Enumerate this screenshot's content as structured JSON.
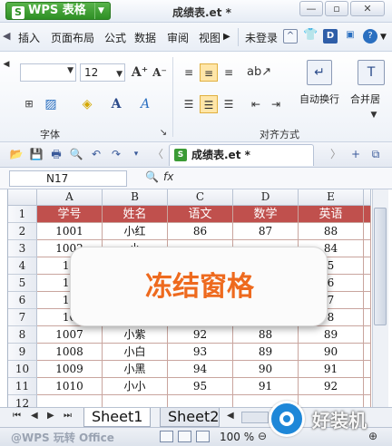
{
  "titlebar": {
    "app_label": "WPS 表格",
    "doc_title": "成绩表.et *"
  },
  "menu": {
    "tabs": [
      "插入",
      "页面布局",
      "公式",
      "数据",
      "审阅",
      "视图"
    ],
    "login": "未登录"
  },
  "ribbon": {
    "font_size": "12",
    "group_font": "字体",
    "group_align": "对齐方式",
    "wrap_label": "自动换行",
    "merge_label": "合并居"
  },
  "qabar": {
    "doc_tab": "成绩表.et *"
  },
  "formula": {
    "name_box": "N17",
    "fx": "fx"
  },
  "sheet": {
    "col_headers": [
      "A",
      "B",
      "C",
      "D",
      "E"
    ],
    "row_numbers": [
      "1",
      "2",
      "3",
      "4",
      "5",
      "6",
      "7",
      "8",
      "9",
      "10",
      "11",
      "12"
    ],
    "header_row": [
      "学号",
      "姓名",
      "语文",
      "数学",
      "英语"
    ],
    "rows": [
      [
        "1001",
        "小红",
        "86",
        "87",
        "88"
      ],
      [
        "1002",
        "小",
        "",
        "",
        "84"
      ],
      [
        "10",
        "",
        "",
        "",
        "5"
      ],
      [
        "10",
        "",
        "",
        "",
        "6"
      ],
      [
        "10",
        "",
        "",
        "",
        "7"
      ],
      [
        "10",
        "",
        "",
        "",
        "8"
      ],
      [
        "1007",
        "小紫",
        "92",
        "88",
        "89"
      ],
      [
        "1008",
        "小白",
        "93",
        "89",
        "90"
      ],
      [
        "1009",
        "小黑",
        "94",
        "90",
        "91"
      ],
      [
        "1010",
        "小小",
        "95",
        "91",
        "92"
      ]
    ],
    "header_color": "#c0504d"
  },
  "sheet_tabs": [
    "Sheet1",
    "Sheet2"
  ],
  "status": {
    "watermark": "@WPS 玩转 Office",
    "zoom": "100 %"
  },
  "banner": {
    "text": "冻结窗格",
    "text_color": "#ee6a1e"
  },
  "logo": {
    "text": "好装机"
  }
}
